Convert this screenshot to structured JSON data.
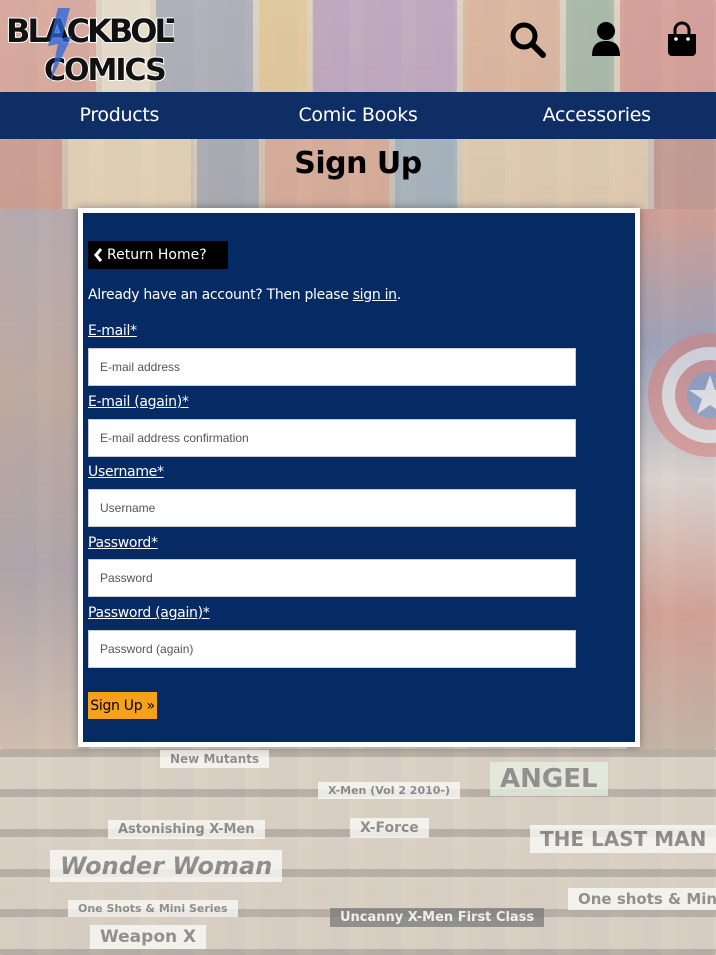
{
  "brand": {
    "logo_line1": "BLACKBOLT",
    "logo_line2": "COMICS"
  },
  "header_icons": [
    "search-icon",
    "user-icon",
    "shopping-bag-icon"
  ],
  "nav": {
    "items": [
      {
        "label": "Products"
      },
      {
        "label": "Comic Books"
      },
      {
        "label": "Accessories"
      }
    ]
  },
  "page": {
    "title": "Sign Up"
  },
  "form": {
    "return_label": "Return Home?",
    "intro_prefix": "Already have an account? Then please ",
    "intro_link": "sign in",
    "intro_suffix": ".",
    "fields": [
      {
        "label": "E-mail*",
        "placeholder": "E-mail address",
        "value": ""
      },
      {
        "label": "E-mail (again)*",
        "placeholder": "E-mail address confirmation",
        "value": ""
      },
      {
        "label": "Username*",
        "placeholder": "Username",
        "value": ""
      },
      {
        "label": "Password*",
        "placeholder": "Password",
        "value": ""
      },
      {
        "label": "Password (again)*",
        "placeholder": "Password (again)",
        "value": ""
      }
    ],
    "submit_label": "Sign Up »"
  },
  "background_labels": [
    "New Mutants",
    "X-Men (Vol 2 2010-)",
    "Astonishing X-Men",
    "X-Force",
    "ANGEL",
    "THE LAST MAN",
    "Wonder Woman",
    "One shots & Mini se",
    "One Shots & Mini Series",
    "Uncanny X-Men First Class",
    "Weapon X"
  ],
  "colors": {
    "nav_bg": "#0f2e66",
    "panel_bg": "#062a63",
    "submit_bg": "#f5a21a",
    "logo_blue": "#2a66d9"
  }
}
